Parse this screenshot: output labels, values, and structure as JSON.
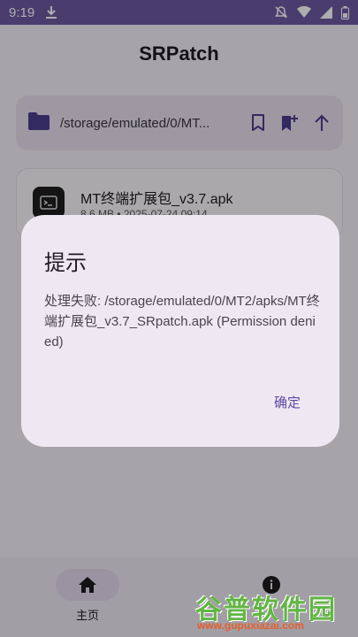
{
  "status_bar": {
    "time": "9:19"
  },
  "app_bar": {
    "title": "SRPatch"
  },
  "path_bar": {
    "path": "/storage/emulated/0/MT..."
  },
  "file_list": [
    {
      "name": "MT终端扩展包_v3.7.apk",
      "meta": "8.6 MB • 2025-07-24 09:14"
    }
  ],
  "dialog": {
    "title": "提示",
    "message": "处理失败: /storage/emulated/0/MT2/apks/MT终端扩展包_v3.7_SRpatch.apk (Permission denied)",
    "ok_label": "确定"
  },
  "bottom_nav": {
    "home_label": "主页"
  },
  "watermark": {
    "brand": "谷普软件园",
    "url": "www.gupuxiazai.com"
  },
  "colors": {
    "status_bar": "#6e5aa3",
    "accent": "#5e4aa0",
    "folder_icon": "#4c3f8f",
    "dialog_bg": "#eee8f3"
  }
}
